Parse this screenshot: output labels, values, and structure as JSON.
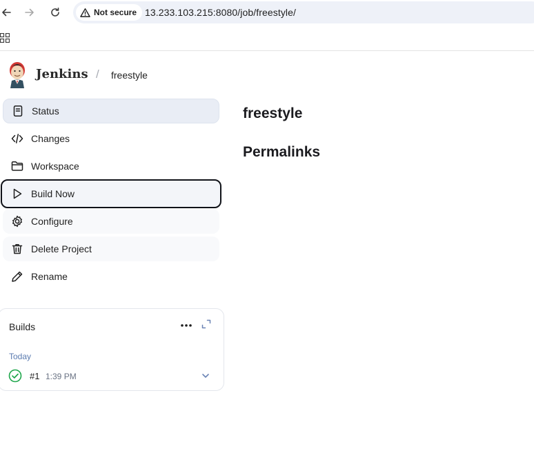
{
  "browser": {
    "security_label": "Not secure",
    "url": "13.233.103.215:8080/job/freestyle/",
    "icons": [
      "back-arrow-icon",
      "forward-arrow-icon",
      "reload-icon",
      "warning-triangle-icon",
      "apps-grid-icon"
    ]
  },
  "header": {
    "brand": "Jenkins",
    "separator": "/",
    "breadcrumb_job": "freestyle",
    "logo_icon": "jenkins-butler-logo"
  },
  "side_panel": {
    "items": [
      {
        "label": "Status",
        "icon": "document-icon",
        "state": "active"
      },
      {
        "label": "Changes",
        "icon": "code-icon",
        "state": "normal"
      },
      {
        "label": "Workspace",
        "icon": "folder-icon",
        "state": "normal"
      },
      {
        "label": "Build Now",
        "icon": "play-icon",
        "state": "focused"
      },
      {
        "label": "Configure",
        "icon": "gear-icon",
        "state": "hover"
      },
      {
        "label": "Delete Project",
        "icon": "trash-icon",
        "state": "hover"
      },
      {
        "label": "Rename",
        "icon": "pencil-icon",
        "state": "normal"
      }
    ]
  },
  "builds": {
    "title": "Builds",
    "day_heading": "Today",
    "entries": [
      {
        "number": "#1",
        "time": "1:39 PM",
        "status": "success"
      }
    ]
  },
  "main": {
    "job_title": "freestyle",
    "permalinks_heading": "Permalinks"
  },
  "colors": {
    "active_bg": "#e9edf5",
    "focus_outline": "#101218",
    "success": "#1ea64b",
    "link_blue": "#5b7bb0",
    "omnibox_bg": "#eef1f8"
  }
}
